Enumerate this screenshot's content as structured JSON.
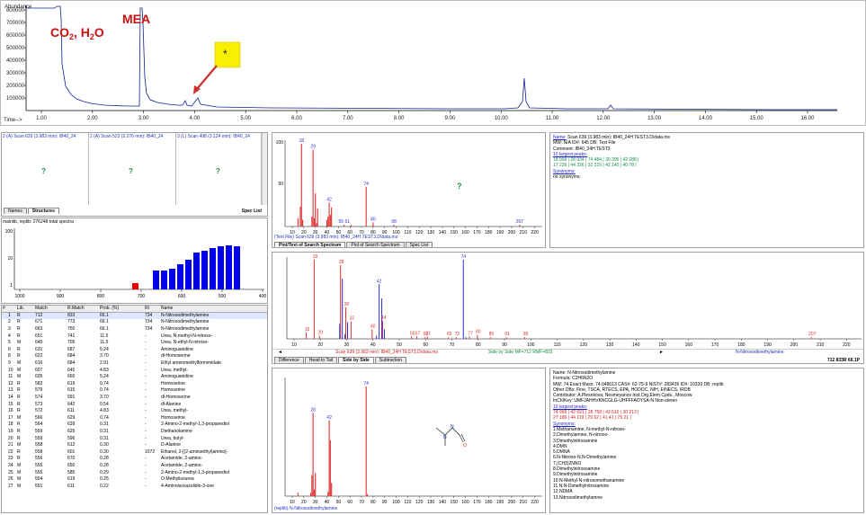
{
  "tic": {
    "ylabel": "Abundance",
    "yticks": [
      "800000",
      "700000",
      "600000",
      "500000",
      "400000",
      "300000",
      "200000",
      "100000"
    ],
    "xlabel": "Time-->",
    "xticks": [
      "1.00",
      "2.00",
      "3.00",
      "4.00",
      "5.00",
      "6.00",
      "7.00",
      "8.00",
      "9.00",
      "10.00",
      "11.00",
      "12.00",
      "13.00",
      "14.00",
      "15.00",
      "16.00"
    ],
    "ann_co2": "CO",
    "ann_co2_sub": "2",
    "ann_h2o": ", H",
    "ann_h2o_sub": "2",
    "ann_h2o_end": "O",
    "ann_mea": "MEA",
    "star": "*"
  },
  "structures": {
    "panels": [
      {
        "hdr": "2 (A) Scan 639 (3.983 min): IB40_24",
        "q": "?"
      },
      {
        "hdr": "2 (A) Scan 523 (3.276 min): IB40_24",
        "q": "?"
      },
      {
        "hdr": "3 (L) Scan 498 (3.124 min): IB40_24",
        "q": "?"
      }
    ],
    "tabs": [
      "Names",
      "Structures"
    ],
    "spec_list": "Spec List"
  },
  "histogram": {
    "label": "mainlib, replib: 276248 total spectra",
    "yticks": [
      "100",
      "10",
      "1"
    ],
    "xticks": [
      "1000",
      "900",
      "800",
      "700",
      "600",
      "500",
      "400"
    ]
  },
  "hits": {
    "columns": [
      "#",
      "Lib.",
      "Match",
      "R.Match",
      "Prob. (%)",
      "RI",
      "Name"
    ],
    "rows": [
      [
        "1",
        "R",
        "712",
        "833",
        "66.1",
        "734",
        "N-Nitrosodimethylamine"
      ],
      [
        "2",
        "R",
        "671",
        "773",
        "66.1",
        "734",
        "N-Nitrosodimethylamine"
      ],
      [
        "3",
        "R",
        "663",
        "750",
        "66.1",
        "734",
        "N-Nitrosodimethylamine"
      ],
      [
        "4",
        "R",
        "651",
        "741",
        "11.5",
        "-",
        "Urea, N-methyl-N-nitroso-"
      ],
      [
        "5",
        "M",
        "645",
        "705",
        "11.5",
        "-",
        "Urea, N-ethyl-N-nitroso-"
      ],
      [
        "6",
        "R",
        "631",
        "687",
        "5.24",
        "-",
        "Aminoguanidine"
      ],
      [
        "8",
        "R",
        "622",
        "684",
        "3.70",
        "-",
        "dl-Homoserine"
      ],
      [
        "9",
        "M",
        "616",
        "684",
        "2.91",
        "-",
        "Ethyl aminomethylformimidate"
      ],
      [
        "10",
        "M",
        "607",
        "645",
        "4.83",
        "-",
        "Urea, methyl-"
      ],
      [
        "11",
        "M",
        "605",
        "660",
        "5.24",
        "-",
        "Aminoguanidine"
      ],
      [
        "12",
        "R",
        "582",
        "619",
        "0.74",
        "-",
        "Homoserine"
      ],
      [
        "13",
        "R",
        "579",
        "615",
        "0.74",
        "-",
        "Homoserine"
      ],
      [
        "14",
        "R",
        "574",
        "591",
        "3.70",
        "-",
        "dl-Homoserine"
      ],
      [
        "15",
        "R",
        "573",
        "642",
        "0.54",
        "-",
        "dl-Alanine"
      ],
      [
        "16",
        "R",
        "572",
        "611",
        "4.83",
        "-",
        "Urea, methyl-"
      ],
      [
        "17",
        "M",
        "566",
        "629",
        "0.74",
        "-",
        "Homoserine"
      ],
      [
        "18",
        "R",
        "564",
        "639",
        "0.31",
        "-",
        "2-Amino-2-methyl-1,3-propanediol"
      ],
      [
        "19",
        "R",
        "559",
        "625",
        "0.31",
        "-",
        "Diethanolamine"
      ],
      [
        "20",
        "R",
        "559",
        "596",
        "0.31",
        "-",
        "Urea, butyl-"
      ],
      [
        "21",
        "M",
        "558",
        "612",
        "0.30",
        "-",
        "D-Alanine"
      ],
      [
        "22",
        "R",
        "558",
        "601",
        "0.30",
        "1072",
        "Ethanol, 2-[(2-aminoethyl)amino]-"
      ],
      [
        "23",
        "R",
        "556",
        "670",
        "0.28",
        "-",
        "Acetamide, 2-amino-"
      ],
      [
        "24",
        "M",
        "555",
        "650",
        "0.28",
        "-",
        "Acetamide, 2-amino-"
      ],
      [
        "25",
        "M",
        "555",
        "585",
        "0.29",
        "-",
        "2-Amino-2-methyl-1,3-propanediol"
      ],
      [
        "26",
        "M",
        "554",
        "619",
        "0.25",
        "-",
        "O-Methylisourea"
      ],
      [
        "27",
        "M",
        "551",
        "611",
        "0.22",
        "-",
        "4-Aminoisoxazolidin-3-one"
      ]
    ]
  },
  "search_spectrum": {
    "peaks": [
      [
        "15",
        "18"
      ],
      [
        "28",
        "29"
      ],
      [
        "42",
        "42"
      ],
      [
        "74",
        "74"
      ],
      [
        "80",
        "80"
      ],
      [
        "98",
        "98"
      ],
      [
        "207",
        "207"
      ],
      [
        "55",
        "55 61"
      ]
    ],
    "xticks": [
      "10",
      "20",
      "30",
      "40",
      "50",
      "60",
      "70",
      "80",
      "90",
      "100",
      "110",
      "120",
      "130",
      "140",
      "150",
      "160",
      "170",
      "180",
      "190",
      "200",
      "210",
      "220"
    ],
    "yticks": [
      "100",
      "50"
    ],
    "q": "?",
    "caption": "(Text File) Scan 639 (3.983 min): IB40_24H TEST3.D\\data.ms",
    "tabs": [
      "Plot/Text of Search Spectrum",
      "Plot of Search Spectrum",
      "Spec List"
    ]
  },
  "search_info": {
    "name_lbl": "Name:",
    "name": "Scan 639 (3.983 min): IB40_24H TEST3.D\\data.ms",
    "mw": "MW:  N/A  ID#:  645  DB:  Text File",
    "comment": "Comment:  IB40_24H TEST3",
    "largest": "10 largest peaks:",
    "peaks1": "18 999 |    28 934 |    74 484 |    30 395 |    42 288 |",
    "peaks2": "17 239 |    44 226 |    32 215 |    43 140 |    40  78 |",
    "syn": "Synonyms:",
    "nosyn": "no synonyms."
  },
  "compare": {
    "xticks": [
      "10",
      "20",
      "30",
      "40",
      "50",
      "60",
      "70",
      "80",
      "90",
      "100",
      "110",
      "120",
      "130",
      "140",
      "150",
      "160",
      "170",
      "180",
      "190",
      "200",
      "210",
      "220"
    ],
    "labels_red": [
      "15",
      "18",
      "20",
      "28",
      "30",
      "32",
      "40",
      "44",
      "55",
      "57",
      "60",
      "61",
      "69",
      "72",
      "77",
      "80",
      "85",
      "91",
      "98",
      "207"
    ],
    "labels_blue": [
      "42",
      "74"
    ],
    "caption_left": "Scan 639 (3.983 min): IB40_24H TEST3.D\\data.ms",
    "caption_mid": "Side by Side MF=712 RMF=833",
    "caption_right": "N-Nitrosodimethylamine",
    "tabs": [
      "Difference",
      "Head to Tail",
      "Side by Side",
      "Subtraction"
    ],
    "score": "712 833R 66.1P"
  },
  "lib_spectrum": {
    "labels": [
      "28",
      "42",
      "74"
    ],
    "xticks": [
      "10",
      "20",
      "30",
      "40",
      "50",
      "60",
      "70",
      "80",
      "90",
      "100",
      "110",
      "120",
      "130",
      "140",
      "150",
      "160",
      "170",
      "180",
      "190",
      "200",
      "210",
      "220"
    ],
    "caption": "(replib) N-Nitrosodimethylamine"
  },
  "lib_info": {
    "name": "Name:  N-Nitrosodimethylamine",
    "formula": "Formula:  C2H6N2O",
    "mw": "MW:  74  Exact Mass:  74.048013  CAS#:  62-75-9  NIST#:  283436  ID#:  10339  DB:  replib",
    "other": "Other DBs:  Fine, TSCA, RTECS, EPA, HODOC, NIH, EINECS, IRDB",
    "contrib": "Contributor:  A.Plesnkova, Nesmeyanov Inst.Org.Elem.Cpds., Moscow",
    "inchi": "InChIKey:  UMFJAHHVKNCGLG-UHFFFAOYSA-N    Non-stereo",
    "largest": "10 largest peaks:",
    "peaks1": "74 999 |    42 691 |    28 758 |    43 510 |    30 213 |",
    "peaks2": "27 186 |    44 119 |    29  62 |    41  41 |    75  21 |",
    "syn": "Synonyms:",
    "synonyms": [
      "1.Methanamine, N-methyl-N-nitroso-",
      "2.Dimethylamine, N-nitroso-",
      "3.Dimethylnitrosamine",
      "4.DMN",
      "5.DMNA",
      "6.N-Nitroso-N,N-Dimethylamine",
      "7.(CH3)2NNO",
      "8.Dimethylnitrosoamine",
      "9.Dimethylnitrosamine",
      "10.N-Methyl-N-nitrosomethanamine",
      "11.N,N-Dimethylnitrosamine",
      "12.NDMA",
      "13.Nitrosodimethylamine"
    ]
  },
  "colors": {
    "tic": "#102090",
    "red": "#e03030",
    "blue": "#3030d0",
    "hist_blue": "#0000ee",
    "hist_red": "#ee0000",
    "annot": "#cc1010",
    "star_bg": "#f8f000"
  }
}
